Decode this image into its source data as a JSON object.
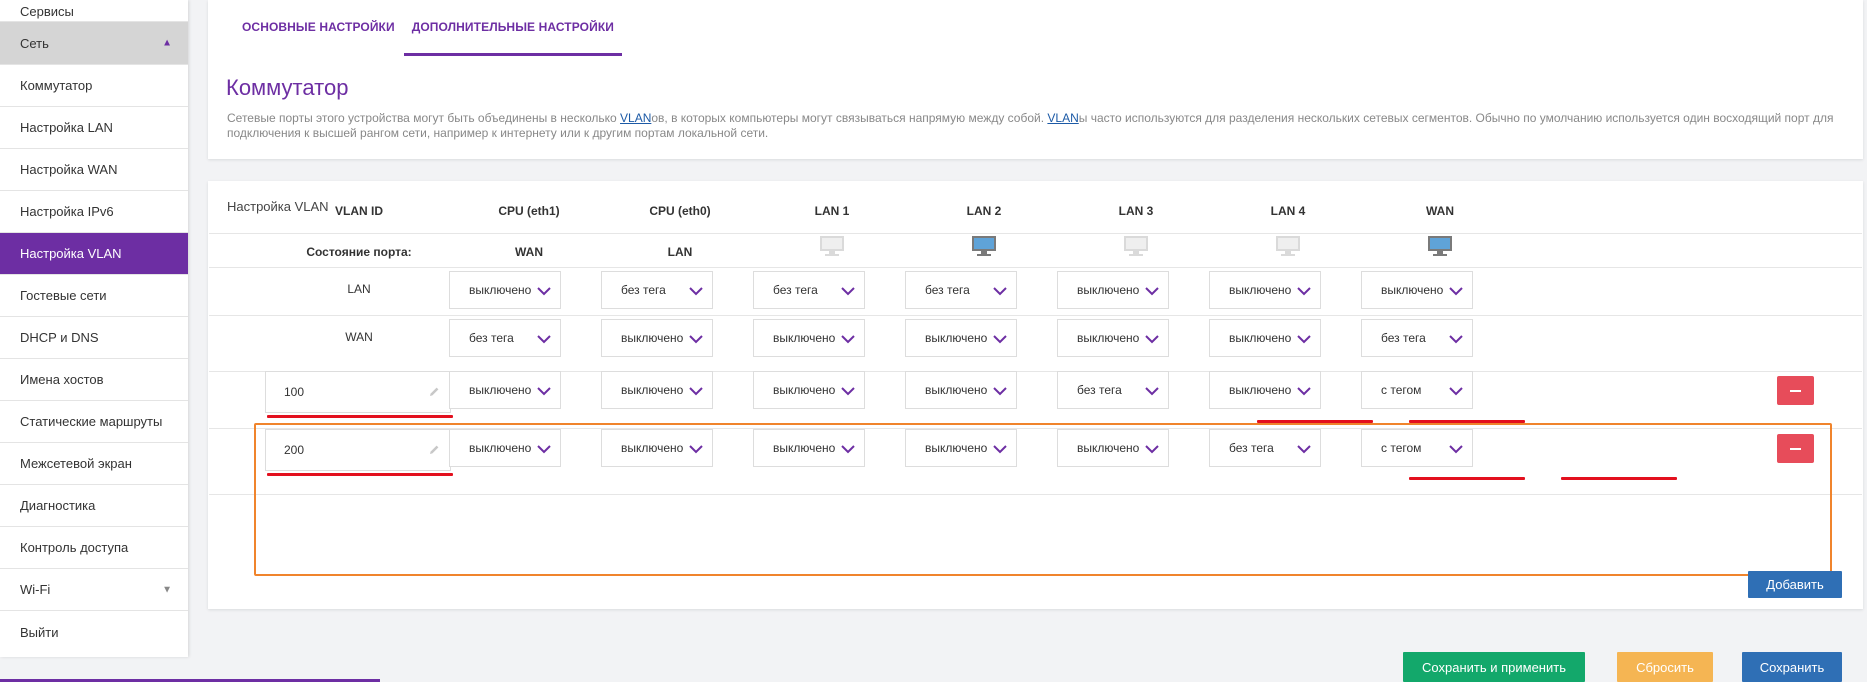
{
  "sidebar": {
    "items": [
      {
        "label": "Сервисы"
      },
      {
        "label": "Сеть"
      },
      {
        "label": "Коммутатор"
      },
      {
        "label": "Настройка LAN"
      },
      {
        "label": "Настройка WAN"
      },
      {
        "label": "Настройка IPv6"
      },
      {
        "label": "Настройка VLAN"
      },
      {
        "label": "Гостевые сети"
      },
      {
        "label": "DHCP и DNS"
      },
      {
        "label": "Имена хостов"
      },
      {
        "label": "Статические маршруты"
      },
      {
        "label": "Межсетевой экран"
      },
      {
        "label": "Диагностика"
      },
      {
        "label": "Контроль доступа"
      },
      {
        "label": "Wi-Fi"
      },
      {
        "label": "Выйти"
      }
    ],
    "icons": {
      "expanded": "triangle-up-icon",
      "collapsed": "triangle-down-icon"
    }
  },
  "tabs": [
    {
      "label": "ОСНОВНЫЕ НАСТРОЙКИ"
    },
    {
      "label": "ДОПОЛНИТЕЛЬНЫЕ НАСТРОЙКИ"
    }
  ],
  "page": {
    "title": "Коммутатор",
    "desc": {
      "p1": "Сетевые порты этого устройства могут быть объединены в несколько ",
      "link1": "VLAN",
      "p2": "ов, в которых компьютеры могут связываться напрямую между собой. ",
      "link2": "VLAN",
      "p3": "ы часто используются для разделения нескольких сетевых сегментов. Обычно по умолчанию используется один восходящий порт для подключения к высшей рангом сети, например к интернету или к другим портам локальной сети."
    }
  },
  "vlan": {
    "title": "Настройка VLAN",
    "headers": [
      "VLAN ID",
      "CPU (eth1)",
      "CPU (eth0)",
      "LAN 1",
      "LAN 2",
      "LAN 3",
      "LAN 4",
      "WAN"
    ],
    "port_state": {
      "label": "Состояние порта:",
      "cpu_eth1": "WAN",
      "cpu_eth0": "LAN",
      "links": [
        false,
        true,
        false,
        false,
        true
      ]
    },
    "rows": [
      {
        "id": "LAN",
        "values": [
          "выключено",
          "без тега",
          "без тега",
          "без тега",
          "выключено",
          "выключено",
          "выключено"
        ]
      },
      {
        "id": "WAN",
        "values": [
          "без тега",
          "выключено",
          "выключено",
          "выключено",
          "выключено",
          "выключено",
          "без тега"
        ]
      },
      {
        "id": "100",
        "values": [
          "выключено",
          "выключено",
          "выключено",
          "выключено",
          "без тега",
          "выключено",
          "с тегом"
        ]
      },
      {
        "id": "200",
        "values": [
          "выключено",
          "выключено",
          "выключено",
          "выключено",
          "выключено",
          "без тега",
          "с тегом"
        ]
      }
    ],
    "add_label": "Добавить"
  },
  "footer": {
    "save_apply": "Сохранить и применить",
    "reset": "Сбросить",
    "save": "Сохранить"
  },
  "colors": {
    "accent": "#6d2ea3",
    "highlight_box": "#f0842c",
    "underline": "#e3101e",
    "delete": "#e74c5a",
    "primary": "#2f6fb5",
    "success": "#13a86b",
    "warning": "#f5b553"
  }
}
